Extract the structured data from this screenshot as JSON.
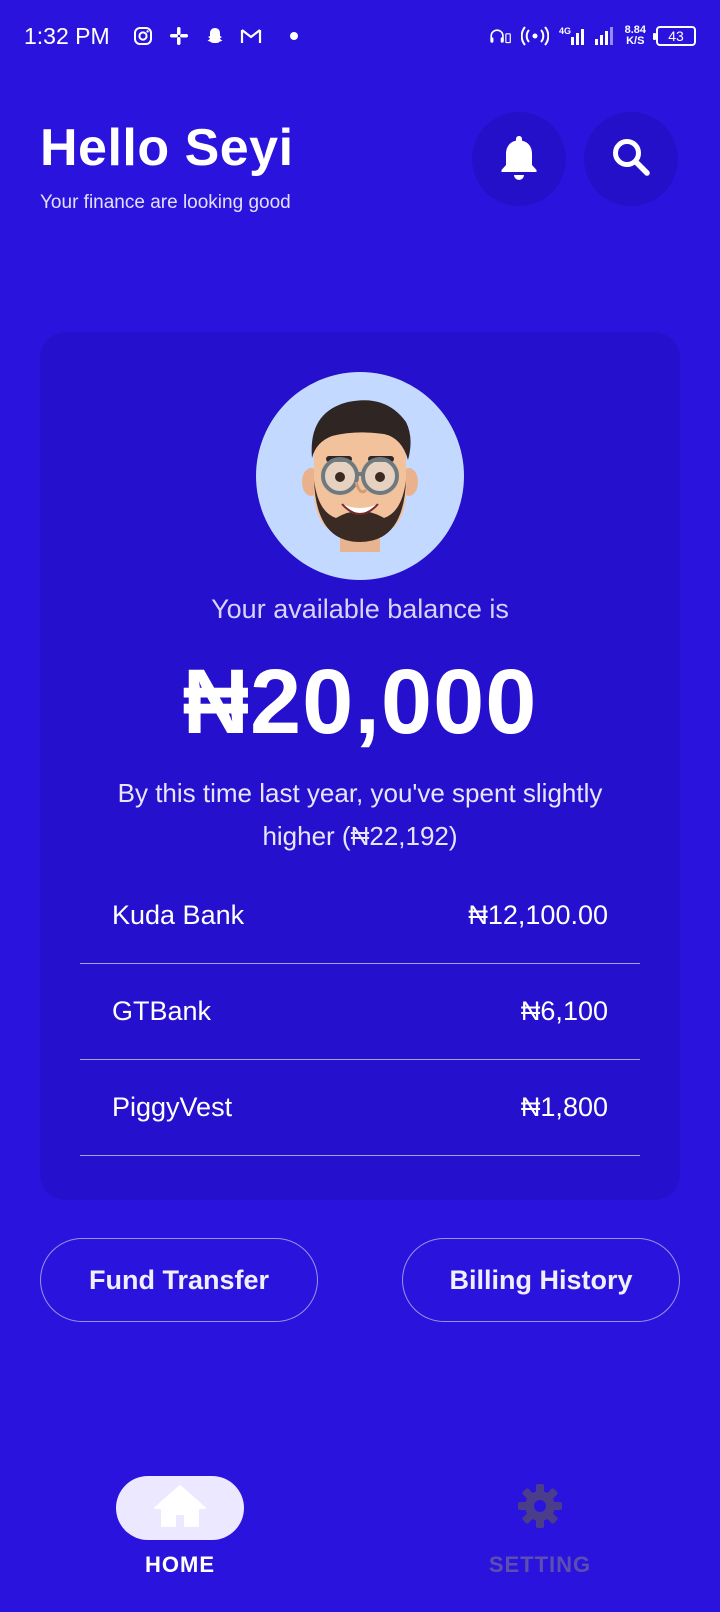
{
  "status_bar": {
    "time": "1:32 PM",
    "net_speed_value": "8.84",
    "net_speed_unit": "K/S",
    "network": "4G",
    "battery": "43",
    "icons": [
      "instagram-icon",
      "slack-icon",
      "snapchat-icon",
      "gmail-icon",
      "headset-icon",
      "hotspot-icon",
      "signal-icon",
      "battery-icon"
    ]
  },
  "header": {
    "greeting": "Hello Seyi",
    "subtitle": "Your finance are looking good"
  },
  "balance_card": {
    "label": "Your available balance is",
    "amount": "₦20,000",
    "comparison": "By this time last year, you've spent slightly higher (₦22,192)",
    "accounts": [
      {
        "name": "Kuda Bank",
        "amount": "₦12,100.00"
      },
      {
        "name": "GTBank",
        "amount": "₦6,100"
      },
      {
        "name": "PiggyVest",
        "amount": "₦1,800"
      }
    ]
  },
  "actions": {
    "fund_transfer": "Fund Transfer",
    "billing_history": "Billing History"
  },
  "bottom_nav": {
    "home": "HOME",
    "setting": "SETTING",
    "active": "home"
  },
  "colors": {
    "background": "#2a14dd",
    "card": "#2510ce",
    "avatar_bg": "#c3d9ff",
    "active_pill": "#ebe8ff",
    "inactive_nav": "#5d4fb0"
  }
}
